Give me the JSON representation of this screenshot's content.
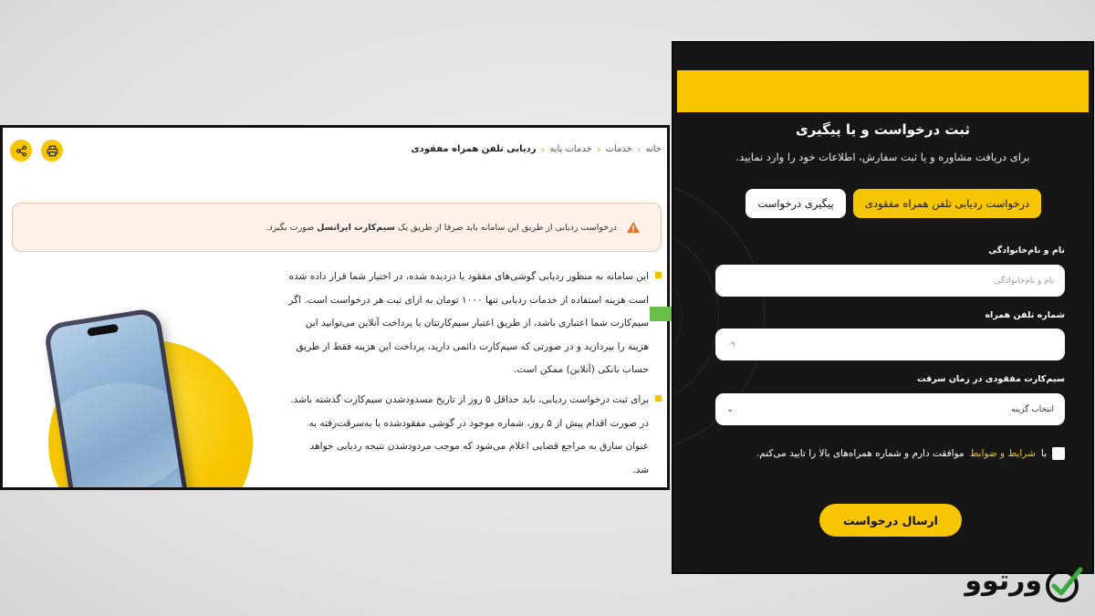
{
  "left": {
    "breadcrumb": [
      "خانه",
      "خدمات",
      "خدمات پایه",
      "ردیابی تلفن همراه مفقودی"
    ],
    "notice": {
      "before": "درخواست ردیابی از طریق این سامانه باید صرفا از طریق یک",
      "bold": "سیم‌کارت ایرانسل",
      "after": "صورت بگیرد."
    },
    "paragraphs": [
      [
        "این سامانه به منظور ردیابی گوشی‌های مفقود یا دزدیده شده، در اختیار شما قرار داده شده",
        "است هزینه استفاده از خدمات ردیابی تنها ۱۰۰۰ تومان به ازای ثبت هر درخواست است. اگر",
        "سیم‌کارت شما اعتباری باشد، از طریق اعتبار سیم‌کارتتان یا پرداخت آنلاین می‌توانید این",
        "هزینه را بپردازید و در صورتی که سیم‌کارت دائمی دارید، پرداخت این هزینه فقط از طریق",
        "حساب بانکی (آنلاین) ممکن است."
      ],
      [
        "برای ثبت درخواست ردیابی، باید حداقل ۵ روز از تاریخ مسدودشدن سیم‌کارت گذشته باشد.",
        "در صورت اقدام پیش از ۵ روز، شماره موجود در گوشی مفقودشده یا به‌سرقت‌رفته به",
        "عنوان سارق به مراجع قضایی اعلام می‌شود که موجب مردودشدن نتیجه ردیابی خواهد",
        "شد."
      ]
    ]
  },
  "right": {
    "title": "ثبت درخواست و یا پیگیری",
    "subtitle": "برای دریافت مشاوره و یا ثبت سفارش، اطلاعات خود را وارد نمایید.",
    "tabs": [
      "درخواست ردیابی تلفن همراه مفقودی",
      "پیگیری درخواست"
    ],
    "fields": {
      "name_label": "نام و نام‌خانوادگی",
      "name_placeholder": "نام و نام‌خانوادگی",
      "phone_label": "شماره تلفن همراه",
      "phone_placeholder": "۰۹",
      "sim_label": "سیم‌کارت مفقودی در زمان سرقت",
      "sim_value": "انتخاب گزینه"
    },
    "terms": {
      "before": "با",
      "link": "شرایط و ضوابط",
      "after": "موافقت دارم و شماره همراه‌های بالا را تایید می‌کنم."
    },
    "submit": "ارسال درخواست"
  },
  "logo": "ورتوو",
  "colors": {
    "accent": "#f7c600",
    "dark_panel": "#161616",
    "arrow": "#6abf4b"
  }
}
